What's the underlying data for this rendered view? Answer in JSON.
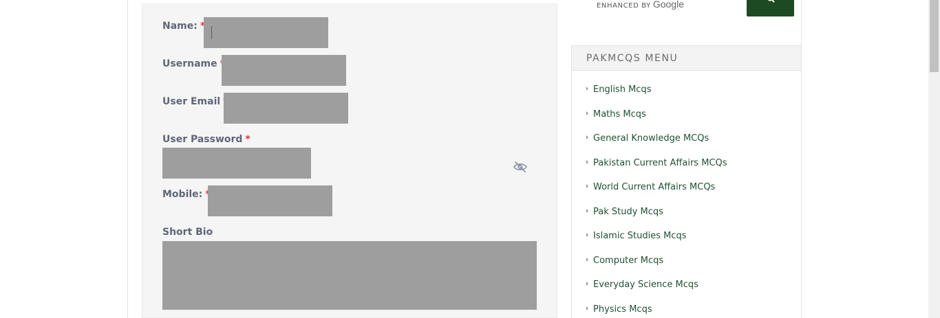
{
  "form": {
    "name_label": "Name:",
    "username_label": "Username",
    "email_label": "User Email",
    "password_label": "User Password",
    "mobile_label": "Mobile:",
    "bio_label": "Short Bio",
    "required_mark": "*",
    "name_value": "",
    "username_value": "",
    "email_value": "",
    "password_value": "",
    "mobile_value": "",
    "bio_value": "",
    "toggle_icon": "eye-slash-icon"
  },
  "search": {
    "enhanced_by": "ENHANCED BY",
    "brand": "Google",
    "button_icon": "search-icon",
    "button_color": "#1d4a22"
  },
  "sidebar_menu": {
    "title": "PAKMCQS MENU",
    "items": [
      {
        "label": "English Mcqs"
      },
      {
        "label": "Maths Mcqs"
      },
      {
        "label": "General Knowledge MCQs"
      },
      {
        "label": "Pakistan Current Affairs MCQs"
      },
      {
        "label": "World Current Affairs MCQs"
      },
      {
        "label": "Pak Study Mcqs"
      },
      {
        "label": "Islamic Studies Mcqs"
      },
      {
        "label": "Computer Mcqs"
      },
      {
        "label": "Everyday Science Mcqs"
      },
      {
        "label": "Physics Mcqs"
      }
    ],
    "link_color": "#1f5131"
  },
  "colors": {
    "required": "#e0393e",
    "label": "#5f6677",
    "field_fill": "#9e9e9e",
    "panel_bg": "#f5f5f5"
  }
}
